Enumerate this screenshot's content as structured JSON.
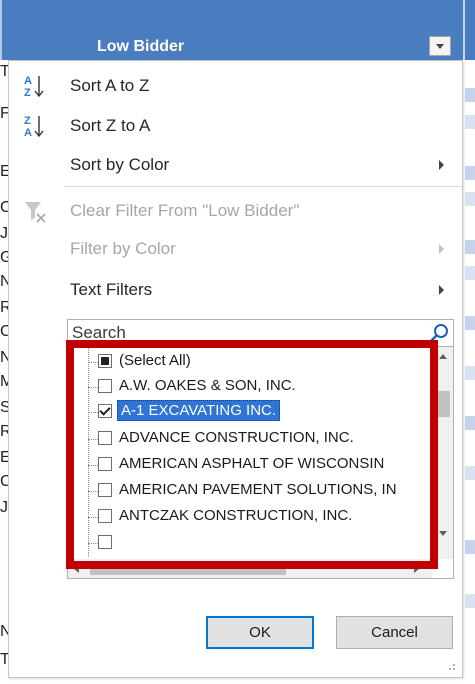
{
  "sheet": {
    "column_header": "Low Bidder",
    "left_column_letters": [
      "T",
      "F",
      "E",
      "C",
      "J",
      "G",
      "N",
      "R",
      "C",
      "N",
      "M",
      "S",
      "R",
      "E",
      "C",
      "J",
      "N",
      "T"
    ]
  },
  "menu": {
    "sort_az": "Sort A to Z",
    "sort_za": "Sort Z to A",
    "sort_by_color": "Sort by Color",
    "clear_filter": "Clear Filter From \"Low Bidder\"",
    "filter_by_color": "Filter by Color",
    "text_filters": "Text Filters"
  },
  "search": {
    "placeholder": "Search"
  },
  "list": {
    "items": [
      {
        "label": "(Select All)",
        "state": "mixed"
      },
      {
        "label": "A.W. OAKES & SON, INC.",
        "state": "unchecked"
      },
      {
        "label": "A-1 EXCAVATING INC.",
        "state": "checked",
        "selected": true
      },
      {
        "label": "ADVANCE CONSTRUCTION, INC.",
        "state": "unchecked"
      },
      {
        "label": "AMERICAN ASPHALT OF WISCONSIN",
        "state": "unchecked"
      },
      {
        "label": "AMERICAN PAVEMENT SOLUTIONS, IN",
        "state": "unchecked"
      },
      {
        "label": "ANTCZAK CONSTRUCTION, INC.",
        "state": "unchecked"
      }
    ]
  },
  "buttons": {
    "ok": "OK",
    "cancel": "Cancel"
  },
  "colors": {
    "header_blue": "#4a7cc0",
    "highlight_red": "#c00000",
    "selection_blue": "#2e75d6"
  }
}
